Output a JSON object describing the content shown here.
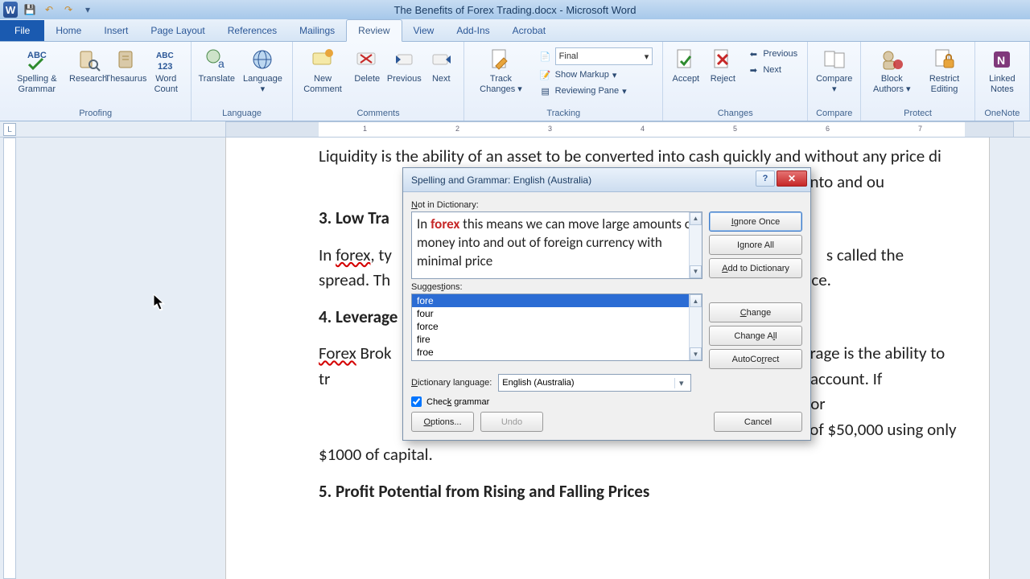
{
  "titlebar": {
    "title": "The Benefits of Forex Trading.docx - Microsoft Word"
  },
  "tabs": {
    "file": "File",
    "items": [
      "Home",
      "Insert",
      "Page Layout",
      "References",
      "Mailings",
      "Review",
      "View",
      "Add-Ins",
      "Acrobat"
    ],
    "active": "Review"
  },
  "ribbon": {
    "proofing": {
      "label": "Proofing",
      "spelling": "Spelling & Grammar",
      "research": "Research",
      "thesaurus": "Thesaurus",
      "wordcount": "Word Count"
    },
    "language": {
      "label": "Language",
      "translate": "Translate",
      "language": "Language"
    },
    "comments": {
      "label": "Comments",
      "new": "New Comment",
      "delete": "Delete",
      "previous": "Previous",
      "next": "Next"
    },
    "tracking": {
      "label": "Tracking",
      "track": "Track Changes",
      "combo": "Final",
      "showmarkup": "Show Markup",
      "reviewpane": "Reviewing Pane"
    },
    "changes": {
      "label": "Changes",
      "accept": "Accept",
      "reject": "Reject",
      "previous": "Previous",
      "next": "Next"
    },
    "compare": {
      "label": "Compare",
      "compare": "Compare"
    },
    "protect": {
      "label": "Protect",
      "block": "Block Authors",
      "restrict": "Restrict Editing"
    },
    "onenote": {
      "label": "OneNote",
      "linked": "Linked Notes"
    }
  },
  "ruler": {
    "ticks": [
      "1",
      "2",
      "3",
      "4",
      "5",
      "6",
      "7"
    ]
  },
  "document": {
    "p1a": "Liquidity is the ability of an asset to be converted into cash quickly and without any price di",
    "p1b": "of money into and ou",
    "h3": "3. Low Tra",
    "p2a": "In ",
    "p2err": "forex",
    "p2b": ", ty",
    "p2c": "s called the spread. Th",
    "p2d": "price.",
    "h4": "4. Leverage",
    "p3a_err": "Forex",
    "p3a": " Brok",
    "p3b": "rage is the ability to tr",
    "p3c": "he trader's account. If",
    "p3d": "on the market for",
    "p3e": "control a trade of $50,000 using only $1000 of capital.",
    "h5": "5. Profit Potential from Rising and Falling Prices"
  },
  "dialog": {
    "title": "Spelling and Grammar: English (Australia)",
    "not_in_dict_label": "Not in Dictionary:",
    "context_pre": "In ",
    "context_err": "forex",
    "context_post": " this means we can move large amounts of money into and out of foreign currency with minimal price",
    "suggestions_label": "Suggestions:",
    "suggestions": [
      "fore",
      "four",
      "force",
      "fire",
      "froe"
    ],
    "dict_lang_label": "Dictionary language:",
    "dict_lang_value": "English (Australia)",
    "check_grammar_label": "Check grammar",
    "check_grammar_checked": true,
    "buttons": {
      "ignore_once": "Ignore Once",
      "ignore_all": "Ignore All",
      "add_dict": "Add to Dictionary",
      "change": "Change",
      "change_all": "Change All",
      "autocorrect": "AutoCorrect",
      "options": "Options...",
      "undo": "Undo",
      "cancel": "Cancel"
    }
  }
}
